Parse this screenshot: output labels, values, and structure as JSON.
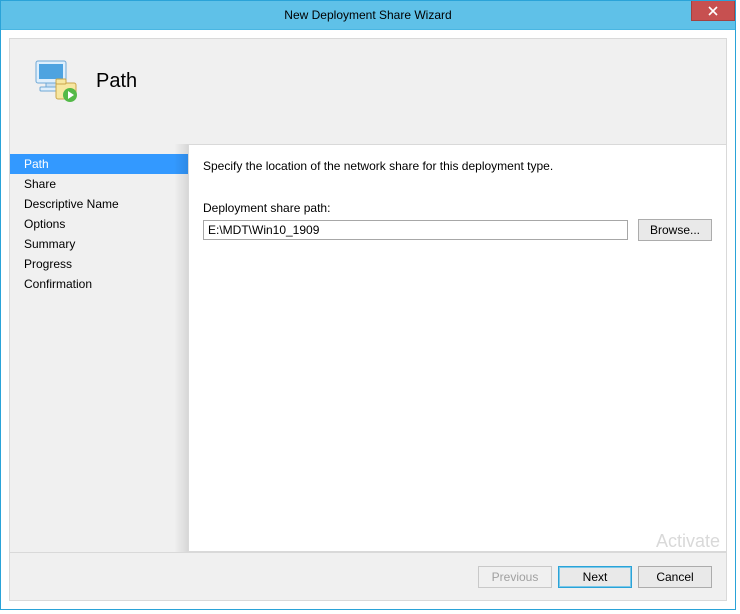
{
  "window": {
    "title": "New Deployment Share Wizard"
  },
  "header": {
    "page_title": "Path"
  },
  "sidebar": {
    "steps": [
      {
        "label": "Path",
        "selected": true
      },
      {
        "label": "Share",
        "selected": false
      },
      {
        "label": "Descriptive Name",
        "selected": false
      },
      {
        "label": "Options",
        "selected": false
      },
      {
        "label": "Summary",
        "selected": false
      },
      {
        "label": "Progress",
        "selected": false
      },
      {
        "label": "Confirmation",
        "selected": false
      }
    ]
  },
  "main": {
    "instruction": "Specify the location of the network share for this deployment type.",
    "path_label": "Deployment share path:",
    "path_value": "E:\\MDT\\Win10_1909",
    "browse_label": "Browse..."
  },
  "footer": {
    "previous_label": "Previous",
    "next_label": "Next",
    "cancel_label": "Cancel"
  },
  "watermark": "Activate"
}
